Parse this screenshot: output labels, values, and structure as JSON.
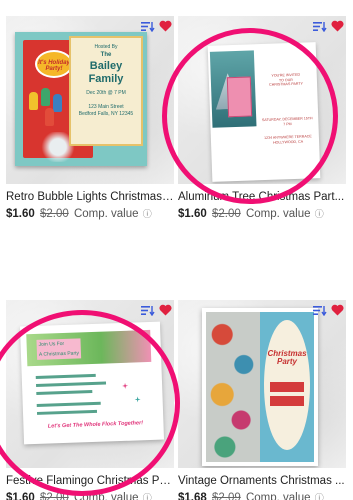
{
  "products": [
    {
      "title": "Retro Bubble Lights Christmas ...",
      "price": "$1.60",
      "old_price": "$2.00",
      "comp_label": "Comp. value",
      "info_icon": "info-icon",
      "preview": {
        "sign_text": "It's Holiday Party!",
        "hosted": "Hosted By",
        "the": "The",
        "family_line1": "Bailey",
        "family_line2": "Family",
        "date": "Dec 20th @ 7 PM",
        "address1": "123 Main Street",
        "address2": "Bedford Falls, NY 12345"
      }
    },
    {
      "title": "Aluminum Tree Christmas Part...",
      "price": "$1.60",
      "old_price": "$2.00",
      "comp_label": "Comp. value",
      "info_icon": "info-icon",
      "preview": {
        "invite_line1": "YOU'RE INVITED",
        "invite_line2": "TO OUR",
        "invite_line3": "CHRISTMAS PARTY",
        "date": "SATURDAY, DECEMBER 15TH",
        "time": "7 PM",
        "address1": "1234 ANYWHERE TERRACE",
        "address2": "HOLLYWOOD, CA"
      }
    },
    {
      "title": "Festive Flamingo Christmas Pa...",
      "price": "$1.60",
      "old_price": "$2.00",
      "comp_label": "Comp. value",
      "info_icon": "info-icon",
      "preview": {
        "join_line1": "Join Us For",
        "join_line2": "A Christmas Party",
        "tagline": "Let's Get The Whole Flock Together!"
      }
    },
    {
      "title": "Vintage Ornaments Christmas ...",
      "price": "$1.68",
      "old_price": "$2.09",
      "comp_label": "Comp. value",
      "info_icon": "info-icon",
      "preview": {
        "title_line1": "Christmas",
        "title_line2": "Party"
      }
    }
  ],
  "icon_colors": {
    "sort": "#3b5bdb",
    "heart": "#e0213f",
    "highlight": "#f00f73"
  }
}
